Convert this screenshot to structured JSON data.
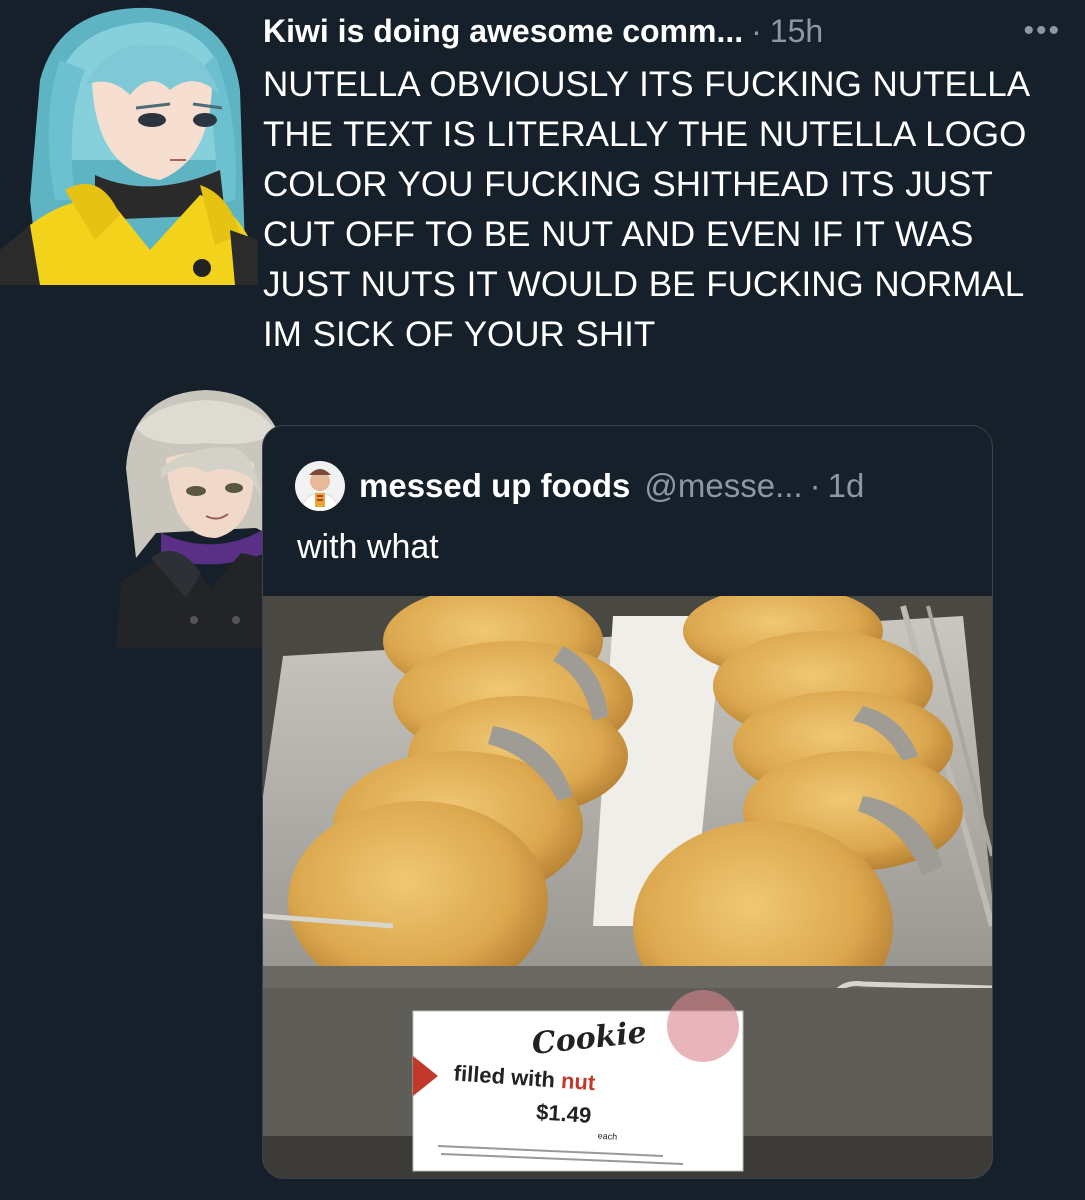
{
  "tweet": {
    "display_name": "Kiwi is doing awesome comm...",
    "separator": "·",
    "time": "15h",
    "more": "•••",
    "text": "NUTELLA OBVIOUSLY ITS FUCKING NUTELLA THE TEXT IS LITERALLY THE NUTELLA LOGO COLOR YOU FUCKING SHITHEAD ITS JUST CUT OFF TO BE NUT AND EVEN IF IT WAS JUST NUTS IT WOULD BE FUCKING NORMAL IM SICK OF YOUR SHIT"
  },
  "quote": {
    "display_name": "messed up foods",
    "handle": "@messe...",
    "separator": "·",
    "time": "1d",
    "text": "with what",
    "image": {
      "sign_title": "Cookie",
      "sign_line_prefix": "filled with ",
      "sign_line_highlight": "nut",
      "sign_price": "$1.49",
      "sign_unit": "each"
    }
  },
  "colors": {
    "background": "#15202b",
    "secondary_text": "#8b98a5",
    "border": "#38444d",
    "kiwi_hair": "#7fc9d6",
    "kiwi_jacket": "#f2d21b",
    "sign_highlight": "#c0392b",
    "cookie": "#e0b35a"
  },
  "icons": {
    "more": "more-horizontal-icon"
  }
}
